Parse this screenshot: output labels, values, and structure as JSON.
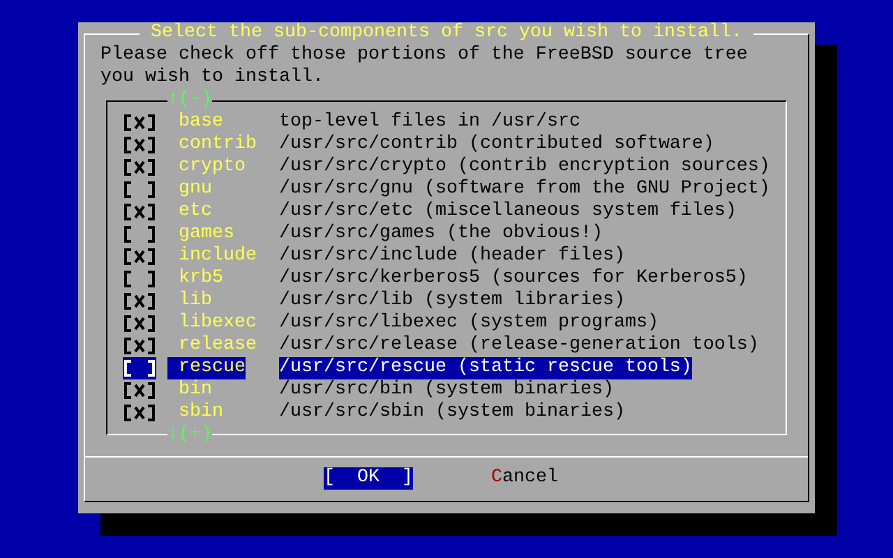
{
  "dialog": {
    "title": "Select the sub-components of src you wish to install.",
    "message": "Please check off those portions of the FreeBSD source tree you wish to install.",
    "list": {
      "scroll_up": "↑(-)",
      "scroll_down": "↓(+)",
      "items": [
        {
          "name": "base",
          "description": "top-level files in /usr/src",
          "checked": true,
          "selected": false
        },
        {
          "name": "contrib",
          "description": "/usr/src/contrib (contributed software)",
          "checked": true,
          "selected": false
        },
        {
          "name": "crypto",
          "description": "/usr/src/crypto (contrib encryption sources)",
          "checked": true,
          "selected": false
        },
        {
          "name": "gnu",
          "description": "/usr/src/gnu (software from the GNU Project)",
          "checked": false,
          "selected": false
        },
        {
          "name": "etc",
          "description": "/usr/src/etc (miscellaneous system files)",
          "checked": true,
          "selected": false
        },
        {
          "name": "games",
          "description": "/usr/src/games (the obvious!)",
          "checked": false,
          "selected": false
        },
        {
          "name": "include",
          "description": "/usr/src/include (header files)",
          "checked": true,
          "selected": false
        },
        {
          "name": "krb5",
          "description": "/usr/src/kerberos5 (sources for Kerberos5)",
          "checked": false,
          "selected": false
        },
        {
          "name": "lib",
          "description": "/usr/src/lib (system libraries)",
          "checked": true,
          "selected": false
        },
        {
          "name": "libexec",
          "description": "/usr/src/libexec (system programs)",
          "checked": true,
          "selected": false
        },
        {
          "name": "release",
          "description": "/usr/src/release (release-generation tools)",
          "checked": true,
          "selected": false
        },
        {
          "name": "rescue",
          "description": "/usr/src/rescue (static rescue tools)",
          "checked": false,
          "selected": true
        },
        {
          "name": "bin",
          "description": "/usr/src/bin (system binaries)",
          "checked": true,
          "selected": false
        },
        {
          "name": "sbin",
          "description": "/usr/src/sbin (system binaries)",
          "checked": true,
          "selected": false
        }
      ]
    },
    "buttons": [
      {
        "label": "[  OK  ]",
        "selected": true
      },
      {
        "hotkey": "C",
        "label": "ancel",
        "selected": false
      }
    ]
  }
}
